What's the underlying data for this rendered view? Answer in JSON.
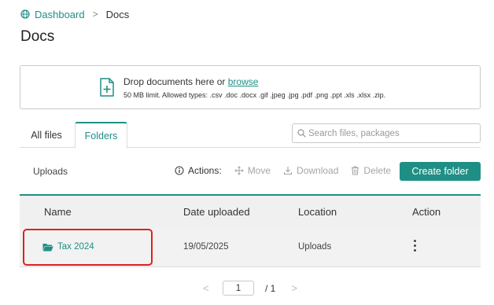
{
  "breadcrumb": {
    "home": "Dashboard",
    "separator": ">",
    "current": "Docs"
  },
  "page": {
    "title": "Docs"
  },
  "dropzone": {
    "prompt": "Drop documents here or",
    "browse_link": "browse",
    "limits": "50 MB limit. Allowed types: .csv .doc .docx .gif .jpeg .jpg .pdf .png .ppt .xls .xlsx .zip."
  },
  "tabs": [
    {
      "label": "All files",
      "active": false
    },
    {
      "label": "Folders",
      "active": true
    }
  ],
  "search": {
    "placeholder": "Search files, packages"
  },
  "toolbar": {
    "path": "Uploads",
    "actions_label": "Actions:",
    "move": "Move",
    "download": "Download",
    "delete": "Delete",
    "create_folder": "Create folder"
  },
  "table": {
    "columns": [
      "Name",
      "Date uploaded",
      "Location",
      "Action"
    ],
    "rows": [
      {
        "name": "Tax 2024",
        "date": "19/05/2025",
        "location": "Uploads"
      }
    ]
  },
  "pagination": {
    "current": "1",
    "of": "/ 1",
    "prev": "<",
    "next": ">"
  },
  "colors": {
    "accent": "#1f8f86",
    "highlight": "#e02020"
  }
}
